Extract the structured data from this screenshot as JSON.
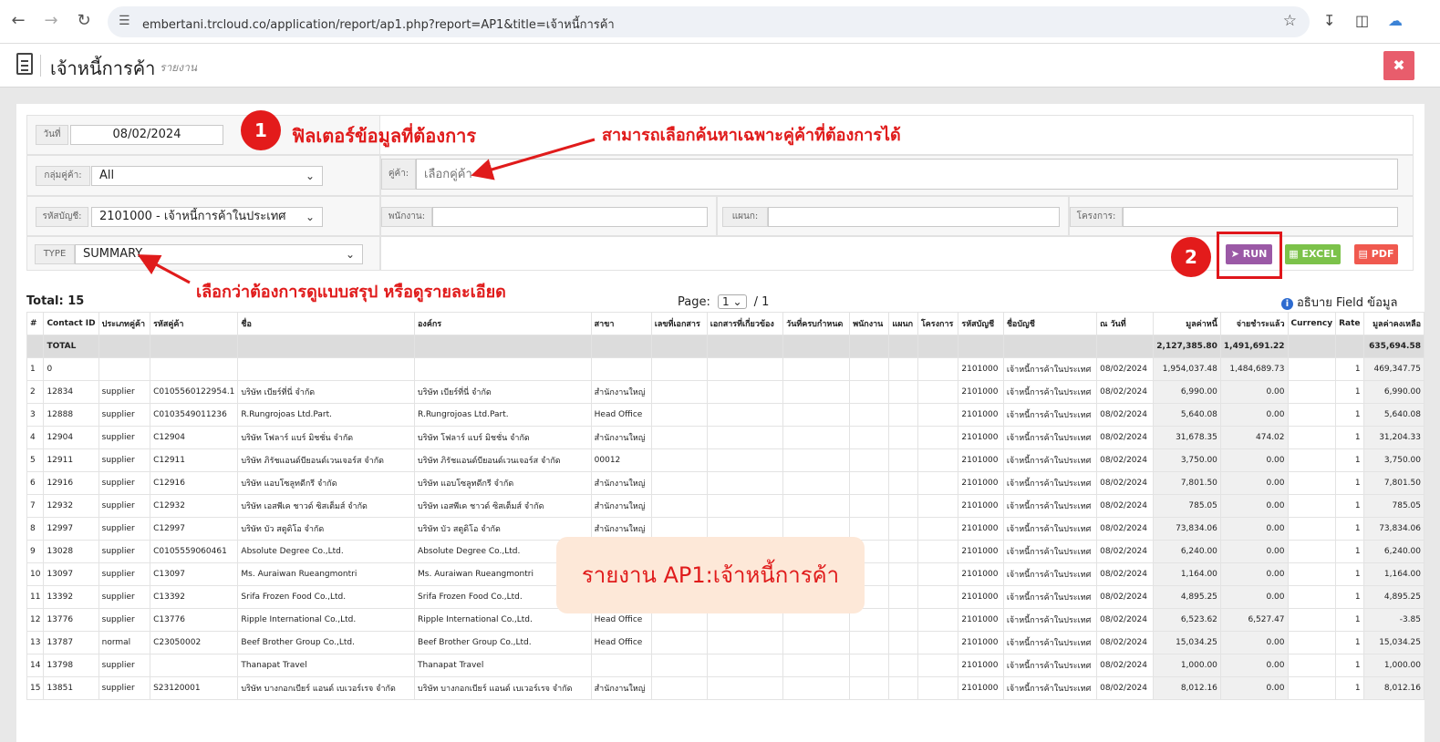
{
  "browser": {
    "url": "embertani.trcloud.co/application/report/ap1.php?report=AP1&title=เจ้าหนี้การค้า"
  },
  "header": {
    "title": "เจ้าหนี้การค้า",
    "subtitle": "รายงาน"
  },
  "filters": {
    "date_label": "วันที่",
    "date_value": "08/02/2024",
    "group_label": "กลุ่มคู่ค้า:",
    "group_value": "All",
    "account_label": "รหัสบัญชี:",
    "account_value": "2101000 - เจ้าหนี้การค้าในประเทศ",
    "type_label": "TYPE",
    "type_value": "SUMMARY",
    "partner_label": "คู่ค้า:",
    "partner_placeholder": "เลือกคู่ค้า",
    "employee_label": "พนักงาน:",
    "department_label": "แผนก:",
    "project_label": "โครงการ:"
  },
  "buttons": {
    "run": "RUN",
    "excel": "EXCEL",
    "pdf": "PDF"
  },
  "annotations": {
    "badge1": "1",
    "badge2": "2",
    "filter_text": "ฟิลเตอร์ข้อมูลที่ต้องการ",
    "partner_text": "สามารถเลือกค้นหาเฉพาะคู่ค้าที่ต้องการได้",
    "type_text": "เลือกว่าต้องการดูแบบสรุป หรือดูรายละเอียด",
    "overlay_text": "รายงาน AP1:เจ้าหนี้การค้า"
  },
  "summary": {
    "total_label": "Total:",
    "total_value": "15",
    "page_label": "Page:",
    "page_value": "1",
    "page_total": "/ 1",
    "info_text": "อธิบาย Field ข้อมูล"
  },
  "table": {
    "columns": [
      "#",
      "Contact ID",
      "ประเภทคู่ค้า",
      "รหัสคู่ค้า",
      "ชื่อ",
      "องค์กร",
      "สาขา",
      "เลขที่เอกสาร",
      "เอกสารที่เกี่ยวข้อง",
      "วันที่ครบกำหนด",
      "พนักงาน",
      "แผนก",
      "โครงการ",
      "รหัสบัญชี",
      "ชื่อบัญชี",
      "ณ วันที่",
      "มูลค่าหนี้",
      "จ่ายชำระแล้ว",
      "Currency",
      "Rate",
      "มูลค่าคงเหลือ"
    ],
    "total_row": [
      "",
      "TOTAL",
      "",
      "",
      "",
      "",
      "",
      "",
      "",
      "",
      "",
      "",
      "",
      "",
      "",
      "",
      "2,127,385.80",
      "1,491,691.22",
      "",
      "",
      "635,694.58"
    ],
    "rows": [
      [
        "1",
        "0",
        "",
        "",
        "",
        "",
        "",
        "",
        "",
        "",
        "",
        "",
        "",
        "2101000",
        "เจ้าหนี้การค้าในประเทศ",
        "08/02/2024",
        "1,954,037.48",
        "1,484,689.73",
        "",
        "1",
        "469,347.75"
      ],
      [
        "2",
        "12834",
        "supplier",
        "C0105560122954.1",
        "บริษัท เบียร์ที่นี่ จำกัด",
        "บริษัท เบียร์ที่นี่ จำกัด",
        "สำนักงานใหญ่",
        "",
        "",
        "",
        "",
        "",
        "",
        "2101000",
        "เจ้าหนี้การค้าในประเทศ",
        "08/02/2024",
        "6,990.00",
        "0.00",
        "",
        "1",
        "6,990.00"
      ],
      [
        "3",
        "12888",
        "supplier",
        "C0103549011236",
        "R.Rungrojoas Ltd.Part.",
        "R.Rungrojoas Ltd.Part.",
        "Head Office",
        "",
        "",
        "",
        "",
        "",
        "",
        "2101000",
        "เจ้าหนี้การค้าในประเทศ",
        "08/02/2024",
        "5,640.08",
        "0.00",
        "",
        "1",
        "5,640.08"
      ],
      [
        "4",
        "12904",
        "supplier",
        "C12904",
        "บริษัท โฟลาร์ แบร์ มิชชั่น จำกัด",
        "บริษัท โฟลาร์ แบร์ มิชชั่น จำกัด",
        "สำนักงานใหญ่",
        "",
        "",
        "",
        "",
        "",
        "",
        "2101000",
        "เจ้าหนี้การค้าในประเทศ",
        "08/02/2024",
        "31,678.35",
        "474.02",
        "",
        "1",
        "31,204.33"
      ],
      [
        "5",
        "12911",
        "supplier",
        "C12911",
        "บริษัท ภิรัชแอนด์บียอนด์เวนเจอร์ส จำกัด",
        "บริษัท ภิรัชแอนด์บียอนด์เวนเจอร์ส จำกัด",
        "00012",
        "",
        "",
        "",
        "",
        "",
        "",
        "2101000",
        "เจ้าหนี้การค้าในประเทศ",
        "08/02/2024",
        "3,750.00",
        "0.00",
        "",
        "1",
        "3,750.00"
      ],
      [
        "6",
        "12916",
        "supplier",
        "C12916",
        "บริษัท แอบโซลูทดีกรี จำกัด",
        "บริษัท แอบโซลูทดีกรี จำกัด",
        "สำนักงานใหญ่",
        "",
        "",
        "",
        "",
        "",
        "",
        "2101000",
        "เจ้าหนี้การค้าในประเทศ",
        "08/02/2024",
        "7,801.50",
        "0.00",
        "",
        "1",
        "7,801.50"
      ],
      [
        "7",
        "12932",
        "supplier",
        "C12932",
        "บริษัท เอสพีเค ชาวด์ ซิสเต็มส์ จำกัด",
        "บริษัท เอสพีเค ชาวด์ ซิสเต็มส์ จำกัด",
        "สำนักงานใหญ่",
        "",
        "",
        "",
        "",
        "",
        "",
        "2101000",
        "เจ้าหนี้การค้าในประเทศ",
        "08/02/2024",
        "785.05",
        "0.00",
        "",
        "1",
        "785.05"
      ],
      [
        "8",
        "12997",
        "supplier",
        "C12997",
        "บริษัท บัว สตูดิโอ จำกัด",
        "บริษัท บัว สตูดิโอ จำกัด",
        "สำนักงานใหญ่",
        "",
        "",
        "",
        "",
        "",
        "",
        "2101000",
        "เจ้าหนี้การค้าในประเทศ",
        "08/02/2024",
        "73,834.06",
        "0.00",
        "",
        "1",
        "73,834.06"
      ],
      [
        "9",
        "13028",
        "supplier",
        "C0105559060461",
        "Absolute Degree Co.,Ltd.",
        "Absolute Degree Co.,Ltd.",
        "",
        "",
        "",
        "",
        "",
        "",
        "",
        "2101000",
        "เจ้าหนี้การค้าในประเทศ",
        "08/02/2024",
        "6,240.00",
        "0.00",
        "",
        "1",
        "6,240.00"
      ],
      [
        "10",
        "13097",
        "supplier",
        "C13097",
        "Ms. Auraiwan Rueangmontri",
        "Ms. Auraiwan Rueangmontri",
        "",
        "",
        "",
        "",
        "",
        "",
        "",
        "2101000",
        "เจ้าหนี้การค้าในประเทศ",
        "08/02/2024",
        "1,164.00",
        "0.00",
        "",
        "1",
        "1,164.00"
      ],
      [
        "11",
        "13392",
        "supplier",
        "C13392",
        "Srifa Frozen Food Co.,Ltd.",
        "Srifa Frozen Food Co.,Ltd.",
        "",
        "",
        "",
        "",
        "",
        "",
        "",
        "2101000",
        "เจ้าหนี้การค้าในประเทศ",
        "08/02/2024",
        "4,895.25",
        "0.00",
        "",
        "1",
        "4,895.25"
      ],
      [
        "12",
        "13776",
        "supplier",
        "C13776",
        "Ripple International Co.,Ltd.",
        "Ripple International Co.,Ltd.",
        "Head Office",
        "",
        "",
        "",
        "",
        "",
        "",
        "2101000",
        "เจ้าหนี้การค้าในประเทศ",
        "08/02/2024",
        "6,523.62",
        "6,527.47",
        "",
        "1",
        "-3.85"
      ],
      [
        "13",
        "13787",
        "normal",
        "C23050002",
        "Beef Brother Group Co.,Ltd.",
        "Beef Brother Group Co.,Ltd.",
        "Head Office",
        "",
        "",
        "",
        "",
        "",
        "",
        "2101000",
        "เจ้าหนี้การค้าในประเทศ",
        "08/02/2024",
        "15,034.25",
        "0.00",
        "",
        "1",
        "15,034.25"
      ],
      [
        "14",
        "13798",
        "supplier",
        "",
        "Thanapat Travel",
        "Thanapat Travel",
        "",
        "",
        "",
        "",
        "",
        "",
        "",
        "2101000",
        "เจ้าหนี้การค้าในประเทศ",
        "08/02/2024",
        "1,000.00",
        "0.00",
        "",
        "1",
        "1,000.00"
      ],
      [
        "15",
        "13851",
        "supplier",
        "S23120001",
        "บริษัท บางกอกเบียร์ แอนด์ เบเวอร์เรจ จำกัด",
        "บริษัท บางกอกเบียร์ แอนด์ เบเวอร์เรจ จำกัด",
        "สำนักงานใหญ่",
        "",
        "",
        "",
        "",
        "",
        "",
        "2101000",
        "เจ้าหนี้การค้าในประเทศ",
        "08/02/2024",
        "8,012.16",
        "0.00",
        "",
        "1",
        "8,012.16"
      ]
    ]
  },
  "colors": {
    "run": "#9b59a6",
    "excel": "#7cc24a",
    "pdf": "#f0594f",
    "annotation": "#e01b1b"
  }
}
